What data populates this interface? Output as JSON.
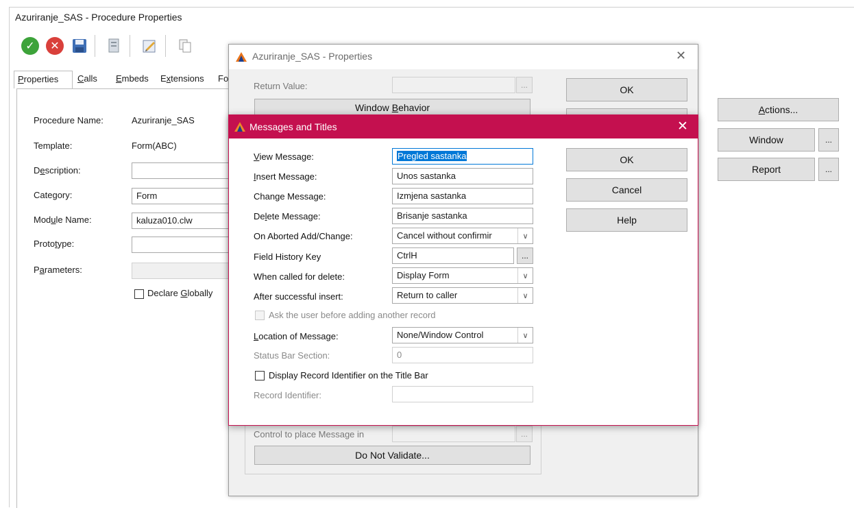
{
  "back_window": {
    "title": "Azuriranje_SAS - Procedure Properties",
    "tabs": [
      {
        "label": "Properties",
        "ul": "P",
        "rest": "roperties"
      },
      {
        "label": "Calls",
        "ul": "C",
        "rest": "alls"
      },
      {
        "label": "Embeds",
        "ul": "E",
        "rest": "mbeds"
      },
      {
        "label": "Extensions",
        "pre": "E",
        "ul": "x",
        "rest": "tensions"
      },
      {
        "label": "Fo"
      }
    ],
    "fields": {
      "procedure_name_label": "Procedure Name:",
      "procedure_name_value": "Azuriranje_SAS",
      "template_label": "Template:",
      "template_value": "Form(ABC)",
      "description_label": "Description:",
      "description_value": "",
      "category_label": "Category:",
      "category_value": "Form",
      "module_name_label": "Module Name:",
      "module_name_value": "kaluza010.clw",
      "prototype_label": "Prototype:",
      "prototype_value": "",
      "parameters_label": "Parameters:",
      "declare_globally_label": "Declare Globally"
    },
    "right_buttons": {
      "actions": "Actions...",
      "window": "Window",
      "report": "Report",
      "ellipsis": "..."
    }
  },
  "mid_window": {
    "title": "Azuriranje_SAS - Properties",
    "return_value_label": "Return Value:",
    "window_behavior_button": "Window Behavior",
    "ok_button": "OK",
    "control_message_label": "Control to place Message in",
    "do_not_validate_button": "Do Not Validate...",
    "ellipsis": "..."
  },
  "dialog": {
    "title": "Messages and Titles",
    "view_message_label": "View Message:",
    "view_message_value": "Pregled sastanka",
    "insert_message_label": "Insert Message:",
    "insert_message_value": "Unos sastanka",
    "change_message_label": "Change Message:",
    "change_message_value": "Izmjena sastanka",
    "delete_message_label": "Delete Message:",
    "delete_message_value": "Brisanje sastanka",
    "on_aborted_label": "On Aborted Add/Change:",
    "on_aborted_value": "Cancel without confirmir",
    "field_history_label": "Field History Key",
    "field_history_value": "CtrlH",
    "called_for_delete_label": "When called for delete:",
    "called_for_delete_value": "Display Form",
    "after_insert_label": "After successful insert:",
    "after_insert_value": "Return to caller",
    "ask_user_label": "Ask the user before adding another record",
    "location_label": "Location of Message:",
    "location_value": "None/Window Control",
    "status_bar_label": "Status Bar Section:",
    "status_bar_value": "0",
    "display_record_label": "Display Record Identifier on the Title Bar",
    "record_identifier_label": "Record Identifier:",
    "record_identifier_value": "",
    "ok_button": "OK",
    "cancel_button": "Cancel",
    "help_button": "Help",
    "ellipsis": "..."
  },
  "colors": {
    "dialog_accent": "#c4104f",
    "selection": "#0078d7"
  }
}
